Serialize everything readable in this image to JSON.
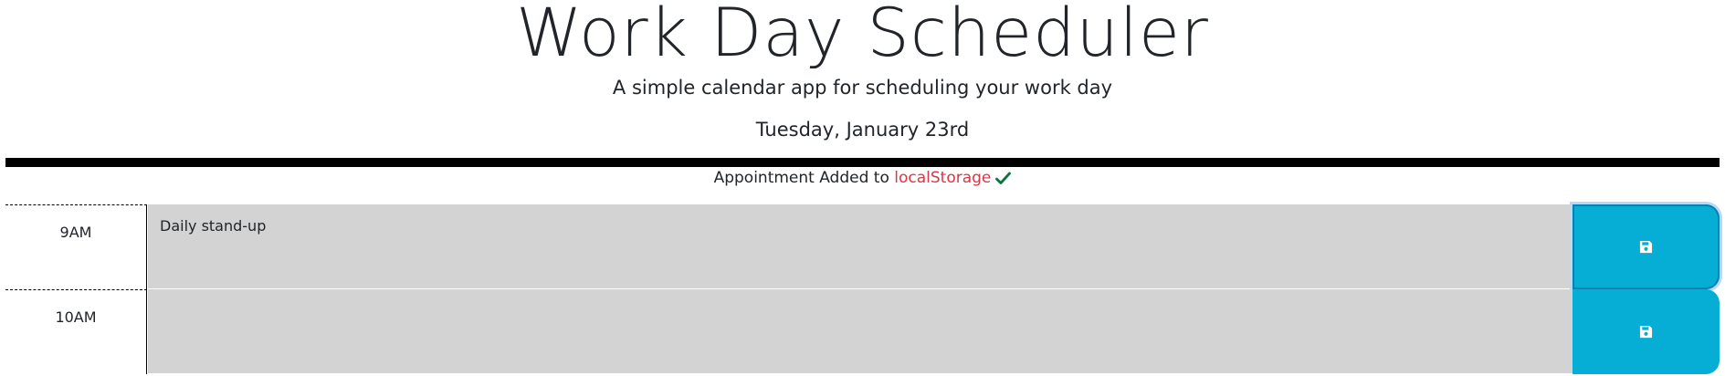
{
  "header": {
    "title": "Work Day Scheduler",
    "subtitle": "A simple calendar app for scheduling your work day",
    "current_day": "Tuesday, January 23rd"
  },
  "notice": {
    "prefix": "Appointment Added to ",
    "storage": "localStorage",
    "icon": "checkmark-icon",
    "storage_color": "#dc3545",
    "check_color": "#198754"
  },
  "time_blocks": [
    {
      "hour": "9AM",
      "description": "Daily stand-up",
      "save_icon": "floppy-disk-icon"
    },
    {
      "hour": "10AM",
      "description": "",
      "save_icon": "floppy-disk-icon"
    }
  ],
  "colors": {
    "past": "#d3d3d3",
    "save_button": "#06aed5",
    "divider": "#000000"
  }
}
